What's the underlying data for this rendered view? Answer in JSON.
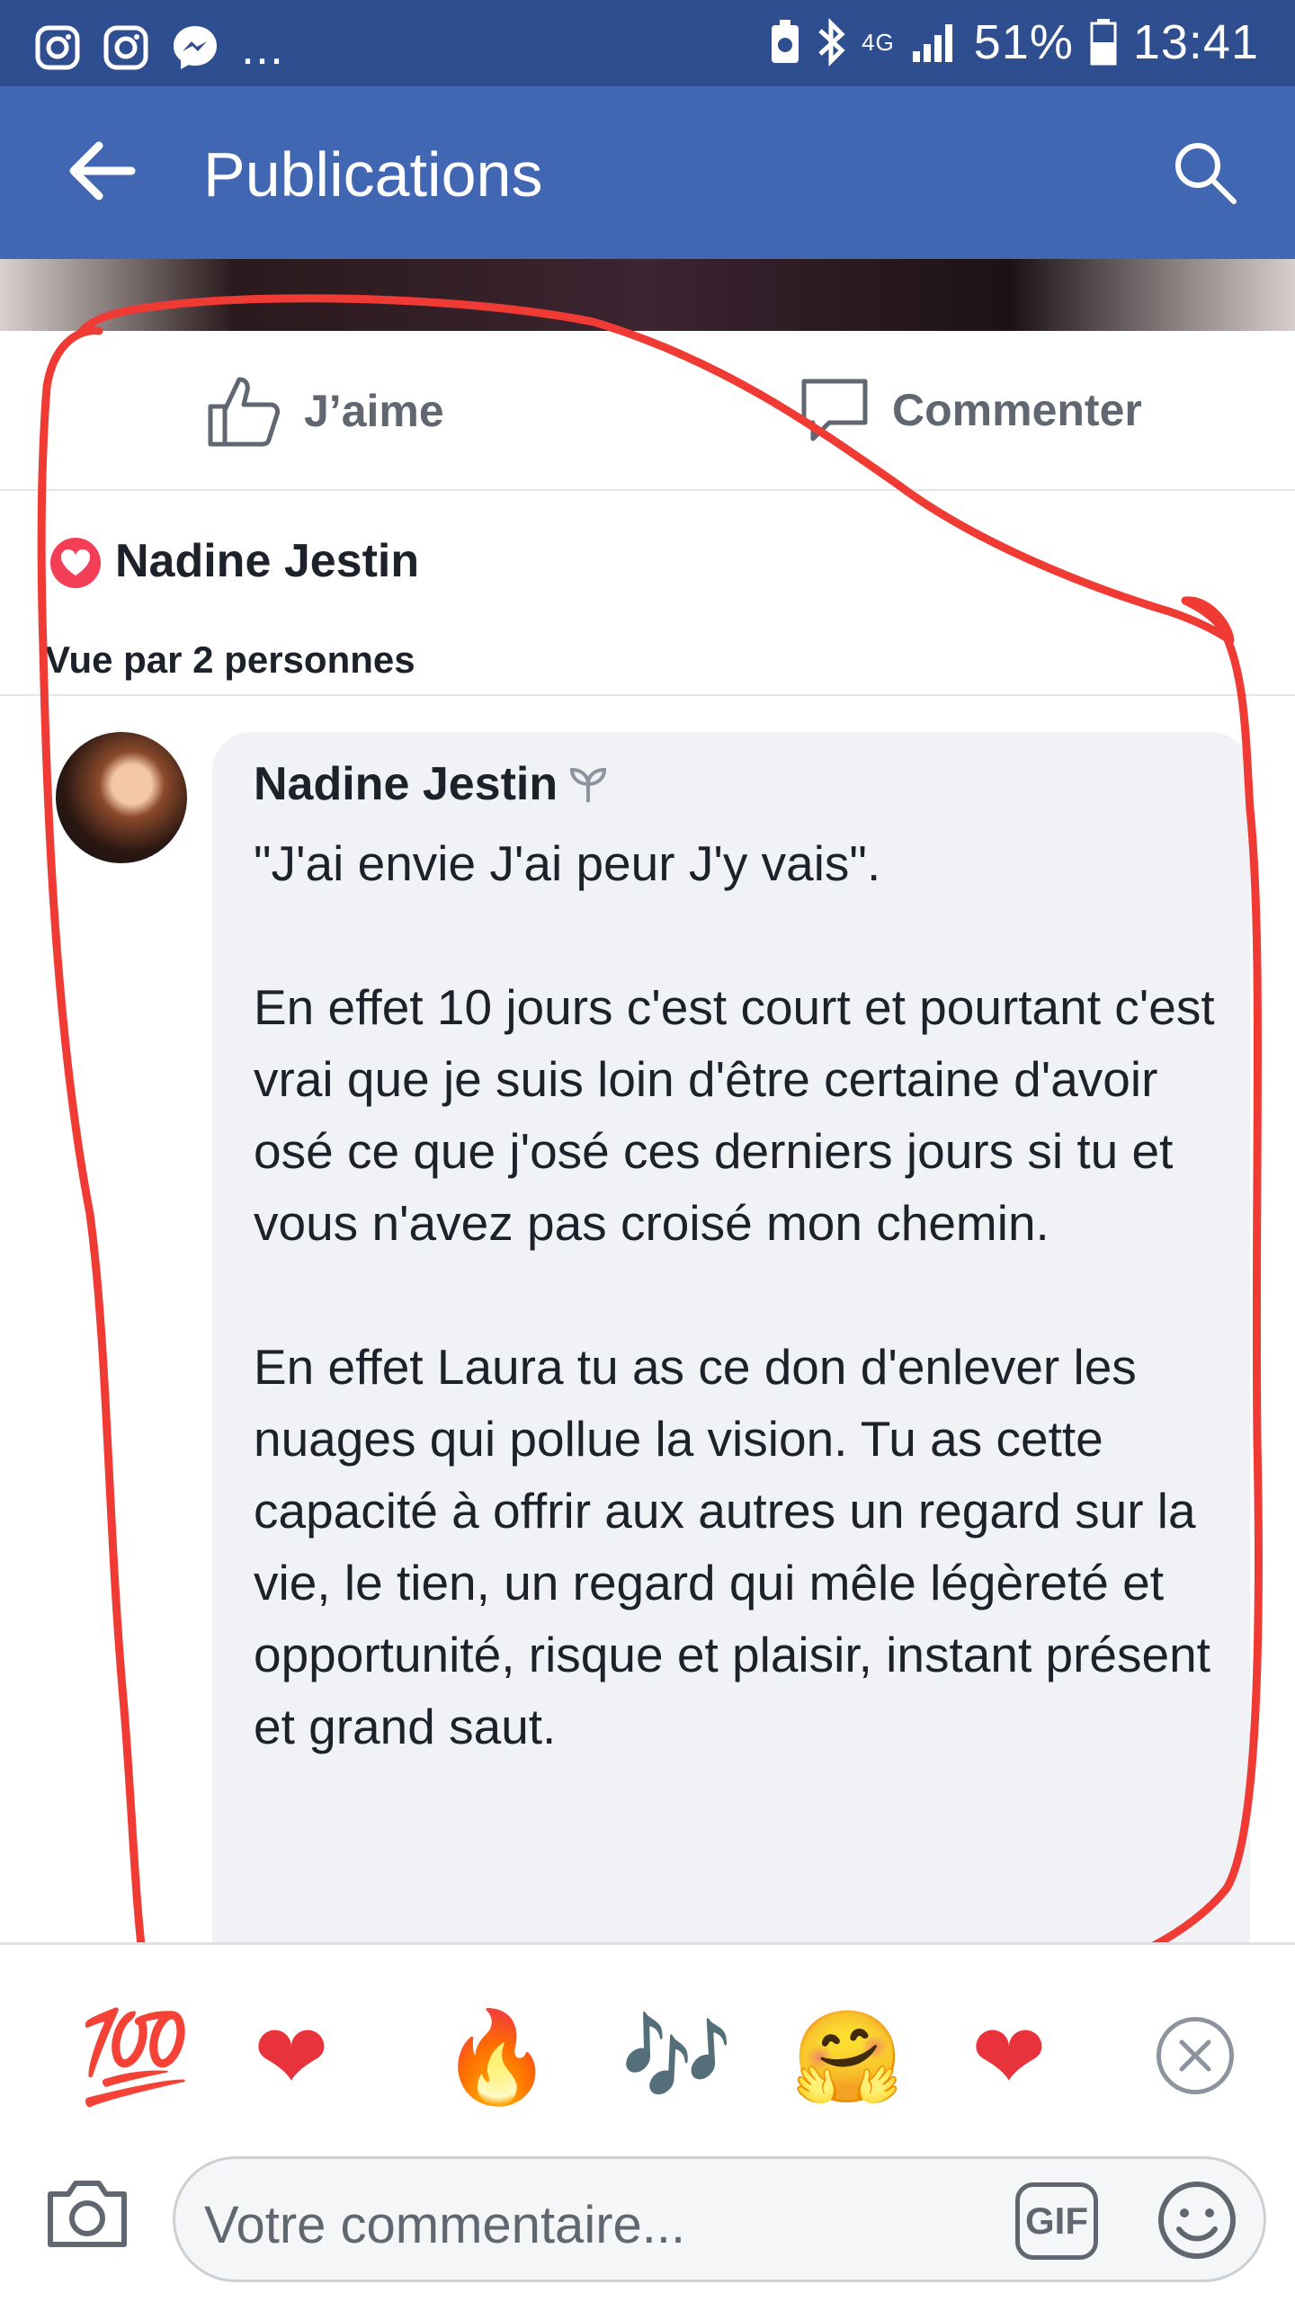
{
  "status_bar": {
    "network": "4G",
    "battery": "51%",
    "time": "13:41",
    "more": "..."
  },
  "app_bar": {
    "title": "Publications"
  },
  "actions": {
    "like_label": "J’aime",
    "comment_label": "Commenter"
  },
  "reactor": {
    "name": "Nadine Jestin",
    "seen_by": "Vue par 2 personnes"
  },
  "comment": {
    "author": "Nadine Jestin",
    "body": "\"J'ai envie J'ai peur J'y vais\".\n\nEn effet 10 jours c'est court et pourtant c'est vrai que je suis loin d'être certaine d'avoir osé ce que j'osé ces derniers jours si tu et vous n'avez pas croisé mon chemin.\n\nEn effet Laura tu as ce don d'enlever les nuages qui pollue la vision. Tu as cette capacité à offrir aux autres un regard sur la vie, le tien, un regard qui mêle légèreté et opportunité, risque et plaisir, instant présent et grand saut."
  },
  "reactions": [
    {
      "name": "hundred-points",
      "glyph": "💯"
    },
    {
      "name": "heart",
      "glyph": "❤"
    },
    {
      "name": "fire",
      "glyph": "🔥"
    },
    {
      "name": "music-notes",
      "glyph": "🎶"
    },
    {
      "name": "hugging-face",
      "glyph": "🤗"
    },
    {
      "name": "red-heart",
      "glyph": "❤"
    }
  ],
  "composer": {
    "placeholder": "Votre commentaire...",
    "gif_label": "GIF"
  },
  "colors": {
    "status_bar": "#2f4e8f",
    "app_bar": "#4267b2",
    "annotation": "#f03a34",
    "bubble": "#f1f2f6"
  }
}
